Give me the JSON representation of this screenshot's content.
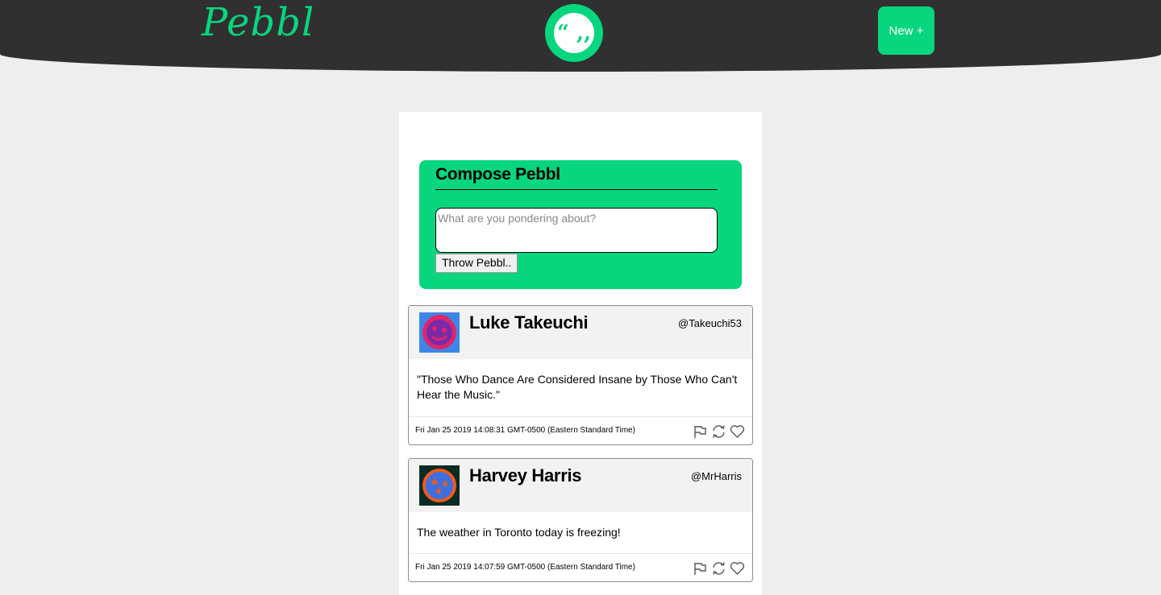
{
  "header": {
    "logo_text": "Pebbl",
    "logo_mark": "“ ,,",
    "new_button_label": "New +"
  },
  "compose": {
    "title": "Compose Pebbl",
    "placeholder": "What are you pondering about?",
    "submit_label": "Throw Pebbl.."
  },
  "posts": [
    {
      "author": "Luke Takeuchi",
      "handle": "@Takeuchi53",
      "avatar_icon": "purple-face-avatar",
      "text": "\"Those Who Dance Are Considered Insane by Those Who Can't Hear the Music.\"",
      "timestamp": "Fri Jan 25 2019 14:08:31 GMT-0500 (Eastern Standard Time)"
    },
    {
      "author": "Harvey Harris",
      "handle": "@MrHarris",
      "avatar_icon": "orange-ring-avatar",
      "text": "The weather in Toronto today is freezing!",
      "timestamp": "Fri Jan 25 2019 14:07:59 GMT-0500 (Eastern Standard Time)"
    }
  ],
  "actions": [
    "flag-icon",
    "retweet-icon",
    "heart-icon"
  ],
  "colors": {
    "accent": "#07d67e",
    "header_bg": "#303030",
    "page_bg": "#eeeeee"
  }
}
